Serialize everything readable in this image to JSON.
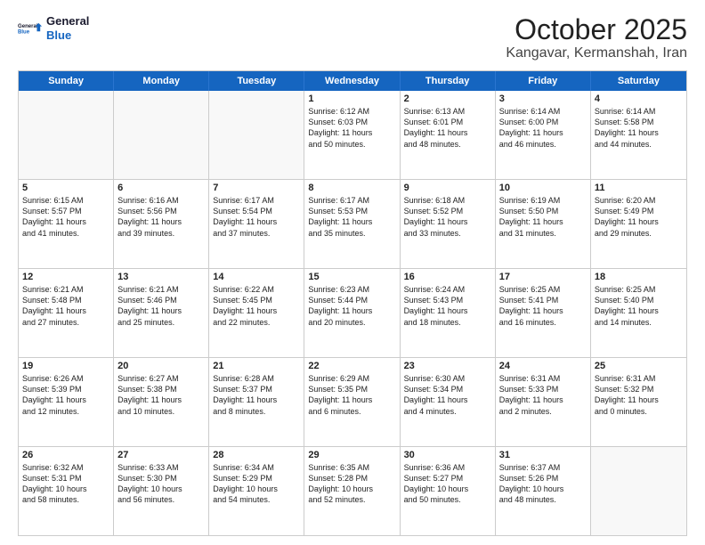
{
  "logo": {
    "line1": "General",
    "line2": "Blue"
  },
  "title": "October 2025",
  "location": "Kangavar, Kermanshah, Iran",
  "weekdays": [
    "Sunday",
    "Monday",
    "Tuesday",
    "Wednesday",
    "Thursday",
    "Friday",
    "Saturday"
  ],
  "rows": [
    [
      {
        "day": "",
        "text": ""
      },
      {
        "day": "",
        "text": ""
      },
      {
        "day": "",
        "text": ""
      },
      {
        "day": "1",
        "text": "Sunrise: 6:12 AM\nSunset: 6:03 PM\nDaylight: 11 hours\nand 50 minutes."
      },
      {
        "day": "2",
        "text": "Sunrise: 6:13 AM\nSunset: 6:01 PM\nDaylight: 11 hours\nand 48 minutes."
      },
      {
        "day": "3",
        "text": "Sunrise: 6:14 AM\nSunset: 6:00 PM\nDaylight: 11 hours\nand 46 minutes."
      },
      {
        "day": "4",
        "text": "Sunrise: 6:14 AM\nSunset: 5:58 PM\nDaylight: 11 hours\nand 44 minutes."
      }
    ],
    [
      {
        "day": "5",
        "text": "Sunrise: 6:15 AM\nSunset: 5:57 PM\nDaylight: 11 hours\nand 41 minutes."
      },
      {
        "day": "6",
        "text": "Sunrise: 6:16 AM\nSunset: 5:56 PM\nDaylight: 11 hours\nand 39 minutes."
      },
      {
        "day": "7",
        "text": "Sunrise: 6:17 AM\nSunset: 5:54 PM\nDaylight: 11 hours\nand 37 minutes."
      },
      {
        "day": "8",
        "text": "Sunrise: 6:17 AM\nSunset: 5:53 PM\nDaylight: 11 hours\nand 35 minutes."
      },
      {
        "day": "9",
        "text": "Sunrise: 6:18 AM\nSunset: 5:52 PM\nDaylight: 11 hours\nand 33 minutes."
      },
      {
        "day": "10",
        "text": "Sunrise: 6:19 AM\nSunset: 5:50 PM\nDaylight: 11 hours\nand 31 minutes."
      },
      {
        "day": "11",
        "text": "Sunrise: 6:20 AM\nSunset: 5:49 PM\nDaylight: 11 hours\nand 29 minutes."
      }
    ],
    [
      {
        "day": "12",
        "text": "Sunrise: 6:21 AM\nSunset: 5:48 PM\nDaylight: 11 hours\nand 27 minutes."
      },
      {
        "day": "13",
        "text": "Sunrise: 6:21 AM\nSunset: 5:46 PM\nDaylight: 11 hours\nand 25 minutes."
      },
      {
        "day": "14",
        "text": "Sunrise: 6:22 AM\nSunset: 5:45 PM\nDaylight: 11 hours\nand 22 minutes."
      },
      {
        "day": "15",
        "text": "Sunrise: 6:23 AM\nSunset: 5:44 PM\nDaylight: 11 hours\nand 20 minutes."
      },
      {
        "day": "16",
        "text": "Sunrise: 6:24 AM\nSunset: 5:43 PM\nDaylight: 11 hours\nand 18 minutes."
      },
      {
        "day": "17",
        "text": "Sunrise: 6:25 AM\nSunset: 5:41 PM\nDaylight: 11 hours\nand 16 minutes."
      },
      {
        "day": "18",
        "text": "Sunrise: 6:25 AM\nSunset: 5:40 PM\nDaylight: 11 hours\nand 14 minutes."
      }
    ],
    [
      {
        "day": "19",
        "text": "Sunrise: 6:26 AM\nSunset: 5:39 PM\nDaylight: 11 hours\nand 12 minutes."
      },
      {
        "day": "20",
        "text": "Sunrise: 6:27 AM\nSunset: 5:38 PM\nDaylight: 11 hours\nand 10 minutes."
      },
      {
        "day": "21",
        "text": "Sunrise: 6:28 AM\nSunset: 5:37 PM\nDaylight: 11 hours\nand 8 minutes."
      },
      {
        "day": "22",
        "text": "Sunrise: 6:29 AM\nSunset: 5:35 PM\nDaylight: 11 hours\nand 6 minutes."
      },
      {
        "day": "23",
        "text": "Sunrise: 6:30 AM\nSunset: 5:34 PM\nDaylight: 11 hours\nand 4 minutes."
      },
      {
        "day": "24",
        "text": "Sunrise: 6:31 AM\nSunset: 5:33 PM\nDaylight: 11 hours\nand 2 minutes."
      },
      {
        "day": "25",
        "text": "Sunrise: 6:31 AM\nSunset: 5:32 PM\nDaylight: 11 hours\nand 0 minutes."
      }
    ],
    [
      {
        "day": "26",
        "text": "Sunrise: 6:32 AM\nSunset: 5:31 PM\nDaylight: 10 hours\nand 58 minutes."
      },
      {
        "day": "27",
        "text": "Sunrise: 6:33 AM\nSunset: 5:30 PM\nDaylight: 10 hours\nand 56 minutes."
      },
      {
        "day": "28",
        "text": "Sunrise: 6:34 AM\nSunset: 5:29 PM\nDaylight: 10 hours\nand 54 minutes."
      },
      {
        "day": "29",
        "text": "Sunrise: 6:35 AM\nSunset: 5:28 PM\nDaylight: 10 hours\nand 52 minutes."
      },
      {
        "day": "30",
        "text": "Sunrise: 6:36 AM\nSunset: 5:27 PM\nDaylight: 10 hours\nand 50 minutes."
      },
      {
        "day": "31",
        "text": "Sunrise: 6:37 AM\nSunset: 5:26 PM\nDaylight: 10 hours\nand 48 minutes."
      },
      {
        "day": "",
        "text": ""
      }
    ]
  ]
}
